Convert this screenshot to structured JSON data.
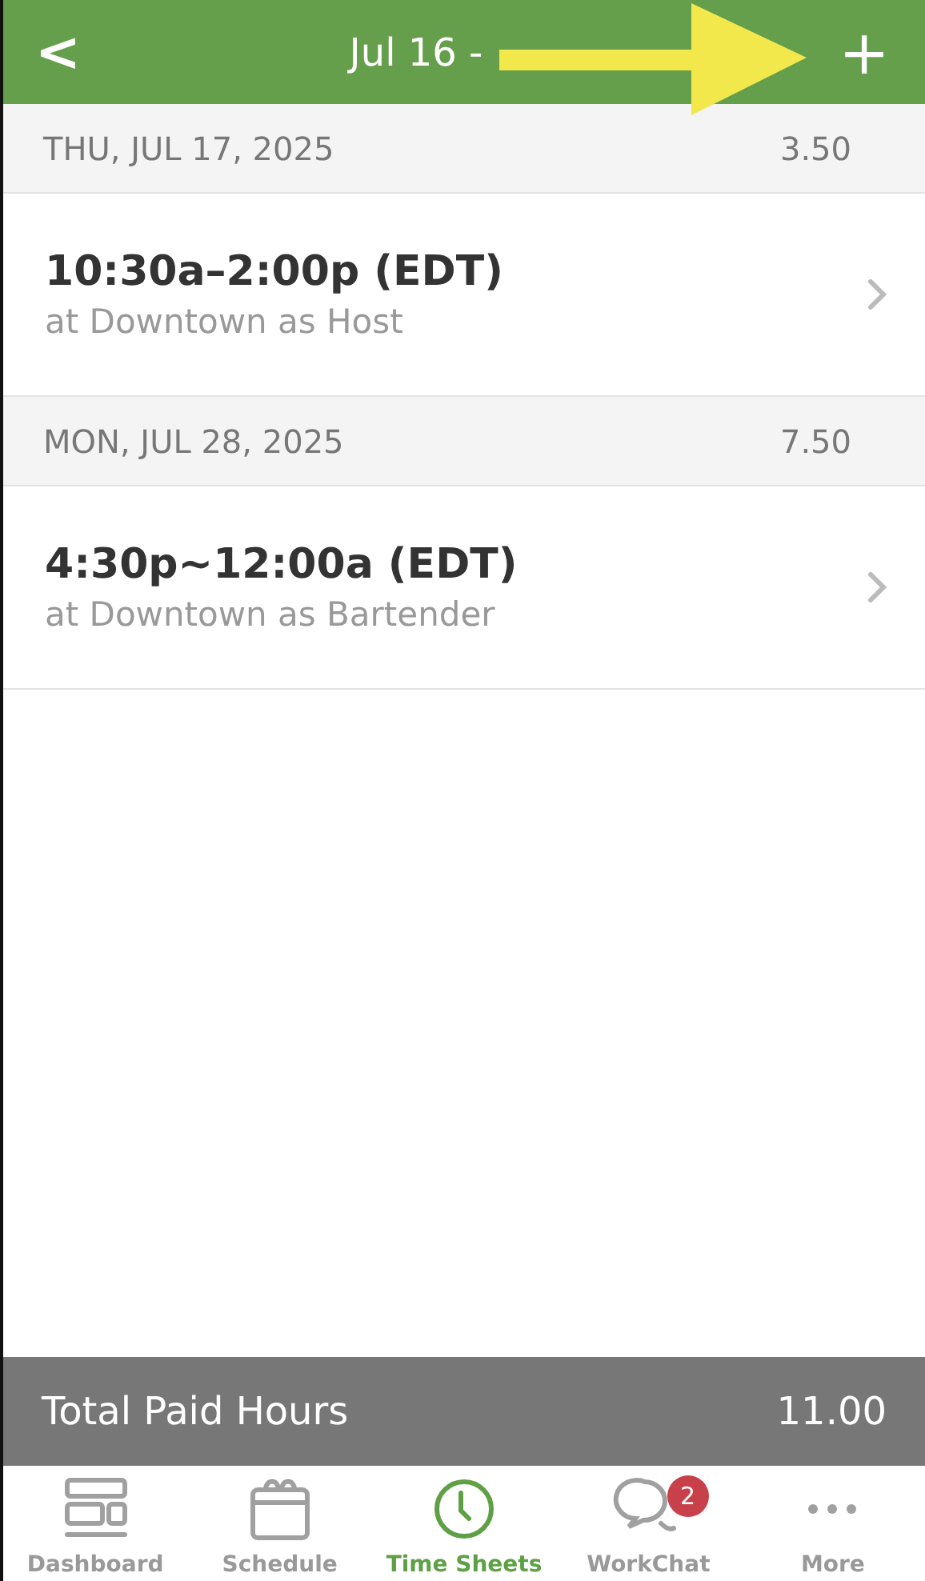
{
  "header": {
    "back": "<",
    "title": "Jul 16 -",
    "add": "+"
  },
  "days": [
    {
      "date": "THU, JUL 17, 2025",
      "hours": "3.50",
      "shifts": [
        {
          "time": "10:30a–2:00p (EDT)",
          "detail": "at Downtown as Host"
        }
      ]
    },
    {
      "date": "MON, JUL 28, 2025",
      "hours": "7.50",
      "shifts": [
        {
          "time": "4:30p~12:00a (EDT)",
          "detail": "at Downtown as Bartender"
        }
      ]
    }
  ],
  "total": {
    "label": "Total Paid Hours",
    "value": "11.00"
  },
  "tabs": [
    {
      "label": "Dashboard",
      "selected": false
    },
    {
      "label": "Schedule",
      "selected": false
    },
    {
      "label": "Time Sheets",
      "selected": true
    },
    {
      "label": "WorkChat",
      "selected": false,
      "badge": "2"
    },
    {
      "label": "More",
      "selected": false
    }
  ]
}
